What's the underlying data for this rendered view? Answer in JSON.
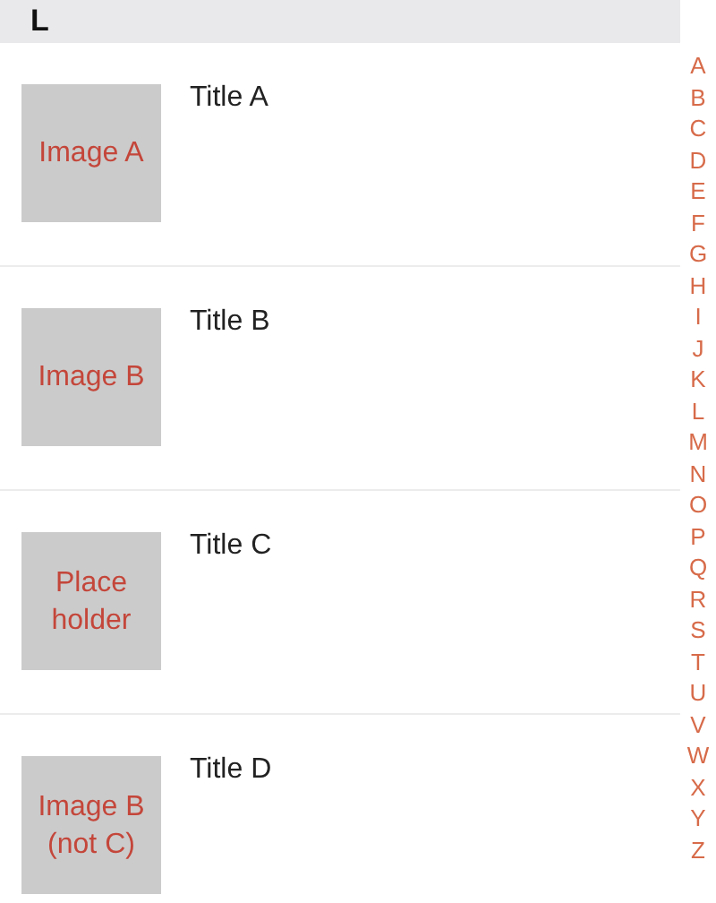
{
  "section_header": "L",
  "items": [
    {
      "title": "Title A",
      "image_text": "Image A"
    },
    {
      "title": "Title B",
      "image_text": "Image B"
    },
    {
      "title": "Title C",
      "image_text": "Place holder"
    },
    {
      "title": "Title D",
      "image_text": "Image B (not C)"
    }
  ],
  "index_letters": [
    "A",
    "B",
    "C",
    "D",
    "E",
    "F",
    "G",
    "H",
    "I",
    "J",
    "K",
    "L",
    "M",
    "N",
    "O",
    "P",
    "Q",
    "R",
    "S",
    "T",
    "U",
    "V",
    "W",
    "X",
    "Y",
    "Z"
  ]
}
